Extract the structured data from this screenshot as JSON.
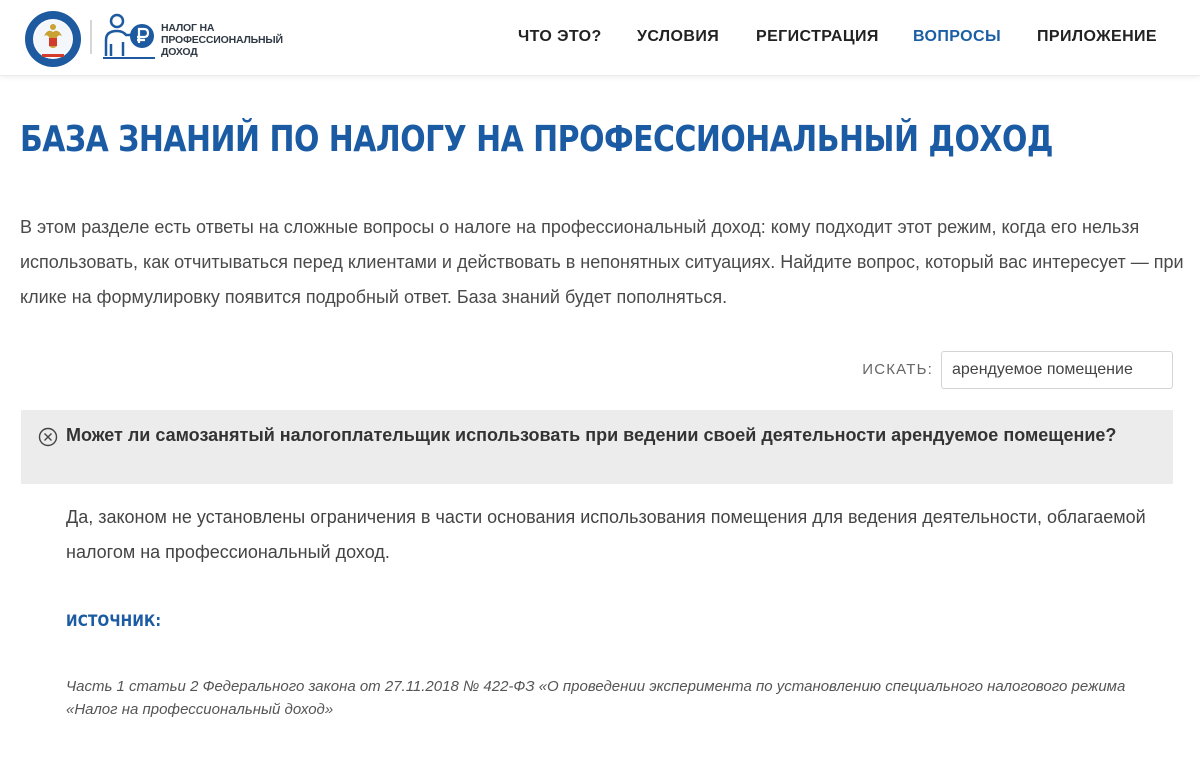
{
  "header": {
    "logo_lines": [
      "НАЛОГ НА",
      "ПРОФЕССИОНАЛЬНЫЙ",
      "ДОХОД"
    ],
    "emblem_icon": "fns-emblem-icon",
    "npd_icon": "person-ruble-icon",
    "nav": [
      {
        "label": "ЧТО ЭТО?",
        "active": false
      },
      {
        "label": "УСЛОВИЯ",
        "active": false
      },
      {
        "label": "РЕГИСТРАЦИЯ",
        "active": false
      },
      {
        "label": "ВОПРОСЫ",
        "active": true
      },
      {
        "label": "ПРИЛОЖЕНИЕ",
        "active": false
      }
    ]
  },
  "page": {
    "title": "БАЗА ЗНАНИЙ ПО НАЛОГУ НА ПРОФЕССИОНАЛЬНЫЙ ДОХОД",
    "intro": "В этом разделе есть ответы на сложные вопросы о налоге на профессиональный доход: кому подходит этот режим, когда его нельзя использовать, как отчитываться перед клиентами и действовать в непонятных ситуациях. Найдите вопрос, который вас интересует — при клике на формулировку появится подробный ответ. База знаний будет пополняться."
  },
  "search": {
    "label": "ИСКАТЬ:",
    "value": "арендуемое помещение"
  },
  "faq": {
    "question": "Может ли самозанятый налогоплательщик использовать при ведении своей деятельности арендуемое помещение?",
    "answer": "Да, законом не установлены ограничения в части основания использования помещения для ведения деятельности, облагаемой налогом на профессиональный доход.",
    "source_heading": "ИСТОЧНИК:",
    "source_text": "Часть 1 статьи 2 Федерального закона от 27.11.2018 № 422-ФЗ «О проведении эксперимента по установлению специального налогового режима «Налог на профессиональный доход»"
  },
  "colors": {
    "brand_blue": "#1b5ba3",
    "active_nav": "#1a5fa5",
    "question_bg": "#ececec"
  }
}
